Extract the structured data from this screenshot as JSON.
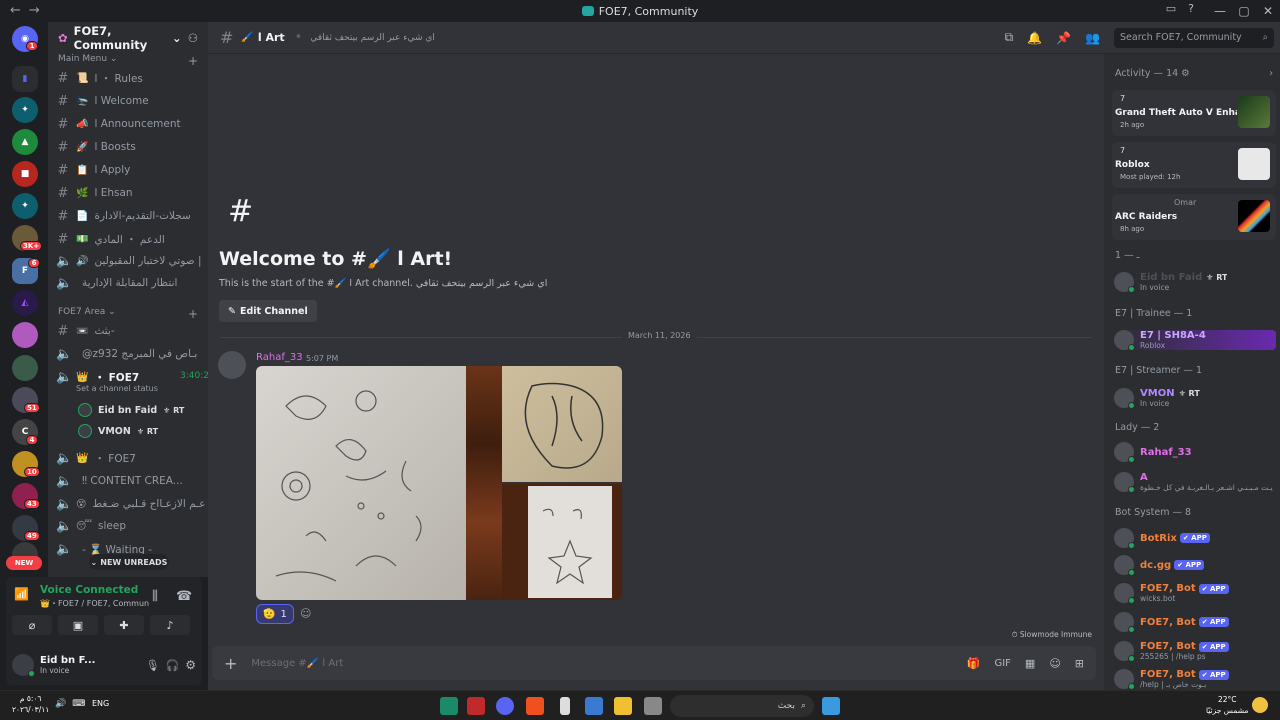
{
  "window": {
    "title": "FOE7, Community"
  },
  "server": {
    "name": "FOE7, Community",
    "categories": {
      "main_menu": "Main Menu",
      "area": "FOE7 Area"
    },
    "channels": [
      {
        "label": "ا ・ Rules",
        "type": "text",
        "emoji": "📜"
      },
      {
        "label": "ا Welcome",
        "type": "text",
        "emoji": "🛬"
      },
      {
        "label": "ا Announcement",
        "type": "text",
        "emoji": "📣"
      },
      {
        "label": "ا Boosts",
        "type": "text",
        "emoji": "🚀"
      },
      {
        "label": "ا Apply",
        "type": "text",
        "emoji": "📋"
      },
      {
        "label": "ا Ehsan",
        "type": "text",
        "emoji": "🌿"
      },
      {
        "label": "سجلات-التقديم-الادارة",
        "type": "text",
        "emoji": "📄"
      },
      {
        "label": "الدعم ・ المادي",
        "type": "text",
        "emoji": "💵"
      },
      {
        "label": "صوتي لاختبار المقبولين |",
        "type": "voice",
        "emoji": "🔊"
      },
      {
        "label": "انتظار المقابلة الإدارية",
        "type": "voice",
        "emoji": ""
      }
    ],
    "area_channels": [
      {
        "label": "بثث-",
        "type": "text",
        "emoji": "📼"
      },
      {
        "label": "@z932 بـاص في المبرمج",
        "type": "voice",
        "emoji": ""
      },
      {
        "label": "・ FOE7",
        "type": "voice",
        "emoji": "👑",
        "timer": "3:40:23",
        "status": "Set a channel status"
      },
      {
        "label": "・ FOE7",
        "type": "voice",
        "emoji": "👑"
      },
      {
        "label": "‼ CONTENT CREA...",
        "type": "voice",
        "emoji": ""
      },
      {
        "label": "عـم الازعـااج قـلبي ضـغط",
        "type": "voice",
        "emoji": "😵"
      },
      {
        "label": "sleep",
        "type": "voice",
        "emoji": "😴"
      },
      {
        "label": "- ⌛ Waiting -",
        "type": "voice",
        "emoji": ""
      }
    ],
    "voice_users": [
      {
        "name": "Eid bn Faid",
        "tag": "RT"
      },
      {
        "name": "VMON",
        "tag": "RT"
      }
    ],
    "new_unreads": "NEW UNREADS",
    "new_pill": "NEW"
  },
  "guild_badges": [
    "1",
    "3K+",
    "6",
    "51",
    "4",
    "10",
    "43",
    "49"
  ],
  "voice": {
    "status": "Voice Connected",
    "channel": "👑・FOE7 / FOE7, Commun..."
  },
  "user": {
    "name": "Eid bn F...",
    "status": "In voice"
  },
  "channel": {
    "name": "ا Art",
    "emoji": "🖌️",
    "topic": "اي شيء عبر الرسم بيتحف ثقافي",
    "welcome_title": "Welcome to #🖌️ ا Art!",
    "welcome_sub": "This is the start of the #🖌️ ا Art channel. اي شيء عبر الرسم بيتحف ثقافي",
    "edit_button": "Edit Channel",
    "date_divider": "March 11, 2026",
    "message_placeholder": "Message #🖌️ ا Art",
    "slowmode": "Slowmode Immune",
    "search_placeholder": "Search FOE7, Community"
  },
  "message": {
    "author": "Rahaf_33",
    "time": "5:07 PM",
    "reaction": {
      "emoji": "🫡",
      "count": "1"
    }
  },
  "members": {
    "activity_header": "Activity — 14",
    "activities": [
      {
        "user": "7",
        "game": "Grand Theft Auto V Enhan...",
        "sub": "2h ago"
      },
      {
        "user": "7",
        "game": "Roblox",
        "sub": "Most played: 12h"
      },
      {
        "user": "Omar",
        "game": "ARC Raiders",
        "sub": "8h ago"
      }
    ],
    "sections": [
      {
        "title": "ـ — 1",
        "members": [
          {
            "name": "Eid bn Faid",
            "tag": "RT",
            "sub": "In voice",
            "color": "#4e5058"
          }
        ]
      },
      {
        "title": "E7 | Trainee — 1",
        "members": [
          {
            "name": "E7 | SH8A-4",
            "tag": "",
            "sub": "Roblox",
            "color": "#c9a7ff"
          }
        ]
      },
      {
        "title": "E7 | Streamer — 1",
        "members": [
          {
            "name": "VMON",
            "tag": "RT",
            "sub": "In voice",
            "color": "#b388ff"
          }
        ]
      },
      {
        "title": "Lady — 2",
        "members": [
          {
            "name": "Rahaf_33",
            "tag": "",
            "sub": "",
            "color": "#e06ee8"
          },
          {
            "name": "A",
            "tag": "",
            "sub": "يـت مـبـنـي اشـعر بـالـغربـة في كل خـطوة",
            "color": "#e06ee8"
          }
        ]
      },
      {
        "title": "Bot System — 8",
        "members": [
          {
            "name": "BotRix",
            "tag": "APP",
            "sub": "",
            "color": "#f0803c"
          },
          {
            "name": "dc.gg",
            "tag": "APP",
            "sub": "",
            "color": "#f0803c"
          },
          {
            "name": "FOE7, Bot",
            "tag": "APP",
            "sub": "wicks.bot",
            "color": "#f0803c"
          },
          {
            "name": "FOE7, Bot",
            "tag": "APP",
            "sub": "",
            "color": "#f0803c"
          },
          {
            "name": "FOE7, Bot",
            "tag": "APP",
            "sub": "255265 | /help ps",
            "color": "#f0803c"
          },
          {
            "name": "FOE7, Bot",
            "tag": "APP",
            "sub": "/help | بـوت خاص بـ",
            "color": "#f0803c"
          }
        ]
      }
    ]
  },
  "taskbar": {
    "time": "٥:٠٦ م",
    "date": "٢٠٢٦/٠٣/١١",
    "lang": "ENG",
    "search": "بحث",
    "temp": "22°C",
    "weather": "مشمس جزئيًا"
  }
}
